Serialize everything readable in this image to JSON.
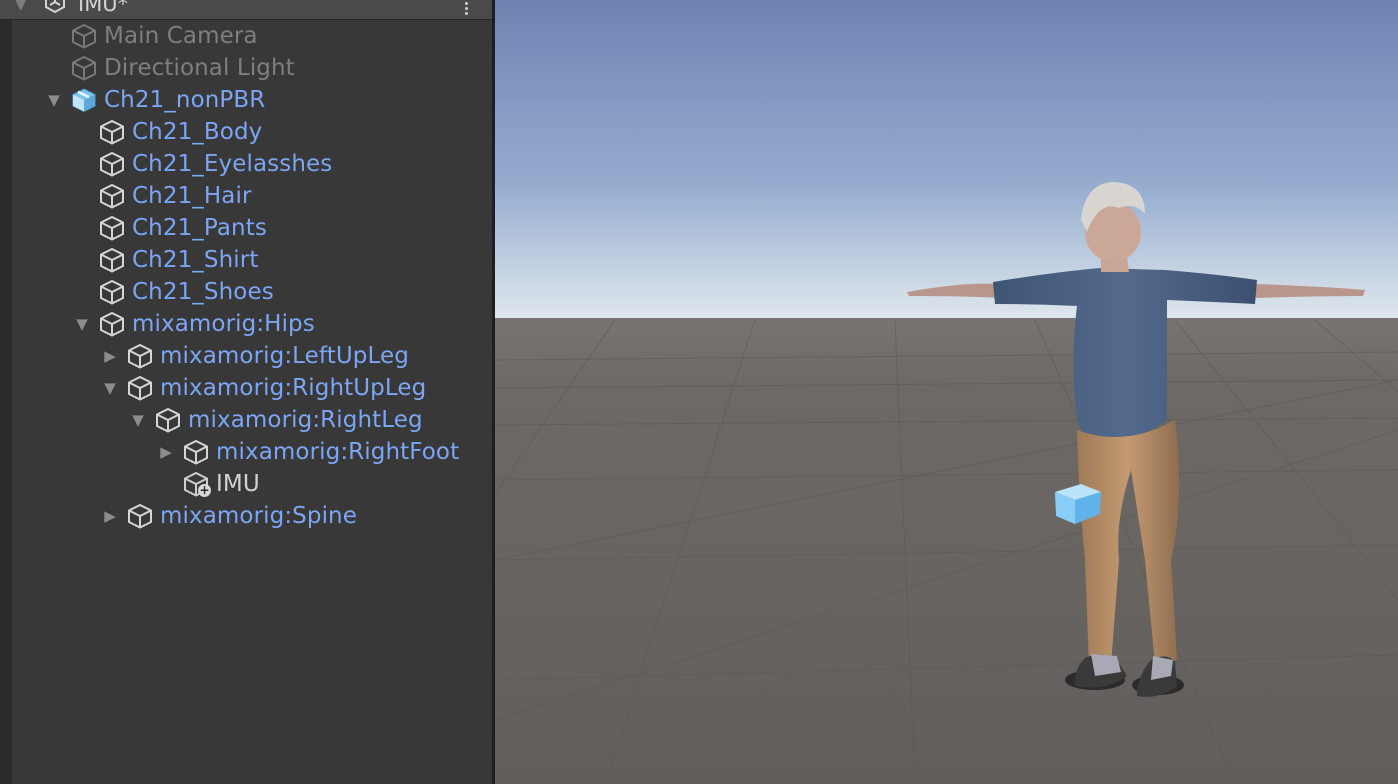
{
  "scene": {
    "title": "IMU*",
    "menu_icon": "kebab-menu-icon"
  },
  "hierarchy": [
    {
      "label": "Main Camera",
      "depth": 0,
      "fold": "none",
      "icon": "gameobject-icon",
      "style": "dim"
    },
    {
      "label": "Directional Light",
      "depth": 0,
      "fold": "none",
      "icon": "gameobject-icon",
      "style": "dim"
    },
    {
      "label": "Ch21_nonPBR",
      "depth": 0,
      "fold": "expanded",
      "icon": "prefab-icon",
      "style": "blue"
    },
    {
      "label": "Ch21_Body",
      "depth": 1,
      "fold": "none",
      "icon": "gameobject-icon",
      "style": "blue"
    },
    {
      "label": "Ch21_Eyelasshes",
      "depth": 1,
      "fold": "none",
      "icon": "gameobject-icon",
      "style": "blue"
    },
    {
      "label": "Ch21_Hair",
      "depth": 1,
      "fold": "none",
      "icon": "gameobject-icon",
      "style": "blue"
    },
    {
      "label": "Ch21_Pants",
      "depth": 1,
      "fold": "none",
      "icon": "gameobject-icon",
      "style": "blue"
    },
    {
      "label": "Ch21_Shirt",
      "depth": 1,
      "fold": "none",
      "icon": "gameobject-icon",
      "style": "blue"
    },
    {
      "label": "Ch21_Shoes",
      "depth": 1,
      "fold": "none",
      "icon": "gameobject-icon",
      "style": "blue"
    },
    {
      "label": "mixamorig:Hips",
      "depth": 1,
      "fold": "expanded",
      "icon": "gameobject-icon",
      "style": "blue"
    },
    {
      "label": "mixamorig:LeftUpLeg",
      "depth": 2,
      "fold": "collapsed",
      "icon": "gameobject-icon",
      "style": "blue"
    },
    {
      "label": "mixamorig:RightUpLeg",
      "depth": 2,
      "fold": "expanded",
      "icon": "gameobject-icon",
      "style": "blue"
    },
    {
      "label": "mixamorig:RightLeg",
      "depth": 3,
      "fold": "expanded",
      "icon": "gameobject-icon",
      "style": "blue"
    },
    {
      "label": "mixamorig:RightFoot",
      "depth": 4,
      "fold": "collapsed",
      "icon": "gameobject-icon",
      "style": "blue"
    },
    {
      "label": "IMU",
      "depth": 4,
      "fold": "none",
      "icon": "gameobject-added-icon",
      "style": "white"
    },
    {
      "label": "mixamorig:Spine",
      "depth": 2,
      "fold": "collapsed",
      "icon": "gameobject-icon",
      "style": "blue"
    }
  ],
  "colors": {
    "prefab": "#7ca6f4",
    "added": "#d2d2d2",
    "inactive": "#7f7f7f",
    "selected_cube": "#7fc8f0"
  }
}
